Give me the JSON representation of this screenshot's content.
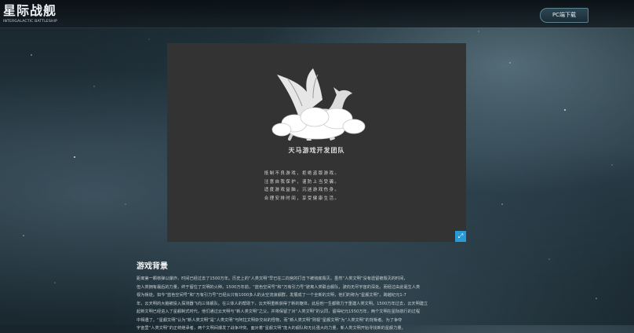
{
  "header": {
    "logo_main": "星际战舰",
    "logo_sub": "INTERGALACTIC BATTLESHIP",
    "pc_download": "PC端下载"
  },
  "video": {
    "team_name": "天马游戏开发团队",
    "notice_lines": [
      "抵制不良游戏，拒绝盗版游戏。",
      "注意自我保护，谨防上当受骗。",
      "适度游戏益脑，沉迷游戏伤身。",
      "合理安排时间，享受健康生活。"
    ],
    "expand_icon": "expand-icon"
  },
  "section": {
    "title": "游戏背景",
    "lines": [
      "距离第一颗核弹以爆炸，时间已经过去了1500万年。历史上的“人类文明”早已在二向宫的打击下被彻底毁灭。虽然“人类文明”没有遗留被毁灭的时间，",
      "但人类拥有最后的力量，终于留住了文明的火种。1500万年前，“蓝色空间号”和“万有引力号”驶离人类联合舰队，驶向无尽宇宙的深处。而经过由此诞生人类",
      "视为叛徒。如今“蓝色空间号”和“万有引力号”已经从只有1000多人的太空流浪舰群，发展成了一个全新的文明，他们的称为“星舰文明”。跨越纪元1-7",
      "年，云天明的大脑被投入探测器飞向三体舰队。在三体人的帮助下，云天明重新获得了新的躯体，此后他一生都致力于重建人类文明。1500万年过去，云天明建立",
      "起新文明已经进入了星舰制式时代，他们通过云天明与“新人类文明”之父，并将保留了对“人类文明”的认同，留得纪元1550万年，两个文明在星际航行的过程",
      "中相遇了。“星舰文明”认为“新人类文明”是“人类文明”与阿拉文明杂交出的怪物，而“新人类文明”则视“星舰文明”为“人类文明”的背叛者。为了争夺",
      "宇宙里“人类文明”的正统继承者，两个文明间爆发了战争冲突。面对着“星舰文明”庞大的舰队和无比强大的力量，新人类文明开始寻找新的星舰力量。"
    ]
  },
  "colors": {
    "accent": "#2a9ad6",
    "video_bg": "#333333"
  }
}
